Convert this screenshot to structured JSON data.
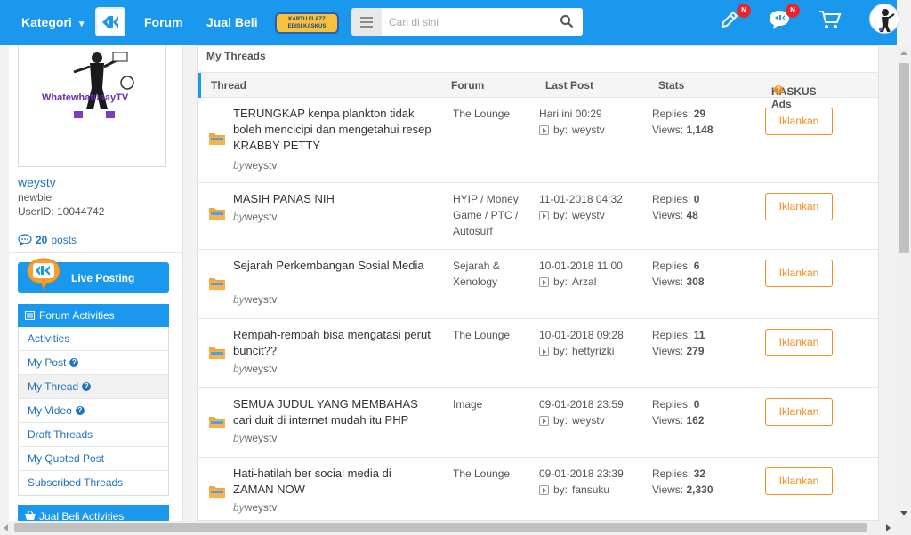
{
  "nav": {
    "kategori": "Kategori",
    "forum": "Forum",
    "jual_beli": "Jual Beli",
    "flazz_line1": "KARTU FLAZZ",
    "flazz_line2": "EDISI KASKUS",
    "search_placeholder": "Cari di sini",
    "badge_edit": "N",
    "badge_chat": "N",
    "colors": {
      "brand": "#1998ed",
      "badge": "#e6262c",
      "accent": "#f28c1c"
    }
  },
  "sidebar": {
    "profile_image_text": "WhatewhatusayTV",
    "username": "weystv",
    "rank": "newbie",
    "user_id": "UserID: 10044742",
    "posts_count": "20",
    "posts_label": "posts",
    "live_posting": "Live Posting",
    "forum_activities": "Forum Activities",
    "menu": [
      {
        "label": "Activities",
        "help": false,
        "active": false
      },
      {
        "label": "My Post",
        "help": true,
        "active": false
      },
      {
        "label": "My Thread",
        "help": true,
        "active": true
      },
      {
        "label": "My Video",
        "help": true,
        "active": false
      },
      {
        "label": "Draft Threads",
        "help": false,
        "active": false
      },
      {
        "label": "My Quoted Post",
        "help": false,
        "active": false
      },
      {
        "label": "Subscribed Threads",
        "help": false,
        "active": false
      }
    ],
    "jual_beli_activities": "Jual Beli Activities"
  },
  "main": {
    "title": "My Threads",
    "headers": {
      "thread": "Thread",
      "forum": "Forum",
      "last_post": "Last Post",
      "stats": "Stats",
      "ads": "KASKUS Ads"
    },
    "by_prefix": "by",
    "last_by_prefix": "by:",
    "replies_label": "Replies:",
    "views_label": "Views:",
    "ad_button": "Iklankan",
    "threads": [
      {
        "title": "TERUNGKAP kenpa plankton tidak boleh mencicipi dan mengetahui resep KRABBY PETTY",
        "author": "weystv",
        "forum": "The Lounge",
        "date": "Hari ini 00:29",
        "last_by": "weystv",
        "replies": "29",
        "views": "1,148"
      },
      {
        "title": "MASIH PANAS NIH",
        "author": "weystv",
        "forum": "HYIP / Money Game / PTC / Autosurf",
        "date": "11-01-2018 04:32",
        "last_by": "weystv",
        "replies": "0",
        "views": "48"
      },
      {
        "title": "Sejarah Perkembangan Sosial Media",
        "author": "weystv",
        "forum": "Sejarah & Xenology",
        "date": "10-01-2018 11:00",
        "last_by": "Arzal",
        "replies": "6",
        "views": "308"
      },
      {
        "title": "Rempah-rempah bisa mengatasi perut buncit??",
        "author": "weystv",
        "forum": "The Lounge",
        "date": "10-01-2018 09:28",
        "last_by": "hettyrizki",
        "replies": "11",
        "views": "279"
      },
      {
        "title": "SEMUA JUDUL YANG MEMBAHAS cari duit di internet mudah itu PHP",
        "author": "weystv",
        "forum": "Image",
        "date": "09-01-2018 23:59",
        "last_by": "weystv",
        "replies": "0",
        "views": "162"
      },
      {
        "title": "Hati-hatilah ber social media di ZAMAN NOW",
        "author": "weystv",
        "forum": "The Lounge",
        "date": "09-01-2018 23:39",
        "last_by": "fansuku",
        "replies": "32",
        "views": "2,330"
      }
    ]
  }
}
